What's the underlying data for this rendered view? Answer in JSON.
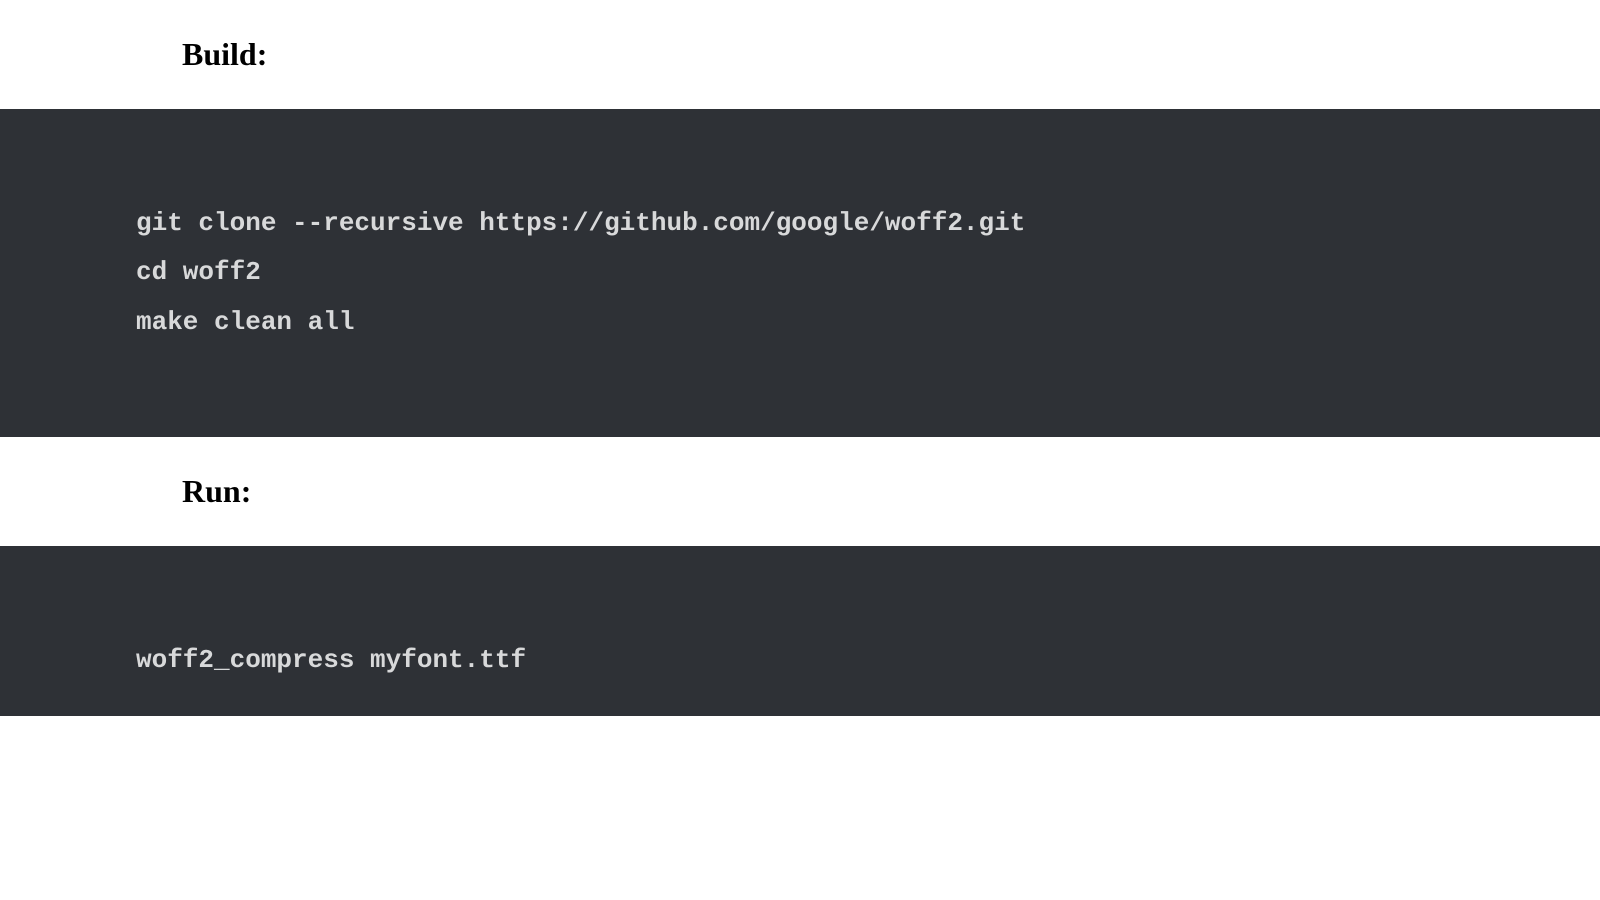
{
  "sections": {
    "build": {
      "heading": "Build:",
      "code": "git clone --recursive https://github.com/google/woff2.git\ncd woff2\nmake clean all"
    },
    "run": {
      "heading": "Run:",
      "code": "woff2_compress myfont.ttf"
    }
  }
}
